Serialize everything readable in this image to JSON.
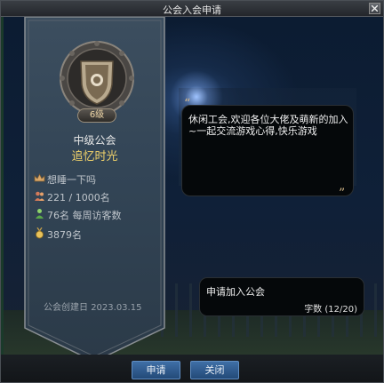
{
  "window": {
    "title": "公会入会申请"
  },
  "guild": {
    "level_badge": "6级",
    "level_title": "中级公会",
    "name": "追忆时光",
    "leader": "想睡一下吗",
    "members": "221 / 1000名",
    "weekly_visitors": "76名 每周访客数",
    "gold": "3879名",
    "founded_label": "公会创建日",
    "founded_date": "2023.03.15"
  },
  "intro": {
    "text": "休闲工会,欢迎各位大佬及萌新的加入~一起交流游戏心得,快乐游戏"
  },
  "application": {
    "text": "申请加入公会",
    "char_count": "字数 (12/20)"
  },
  "buttons": {
    "apply": "申请",
    "close": "关闭"
  },
  "icons": {
    "close": "close-icon",
    "emblem": "guild-emblem-icon",
    "leader": "crown-icon",
    "members": "members-icon",
    "visitors": "visitor-icon",
    "gold": "gold-medal-icon"
  },
  "colors": {
    "guild_name": "#f2d36a",
    "button": "#2f5d92",
    "banner": "#37485a"
  }
}
